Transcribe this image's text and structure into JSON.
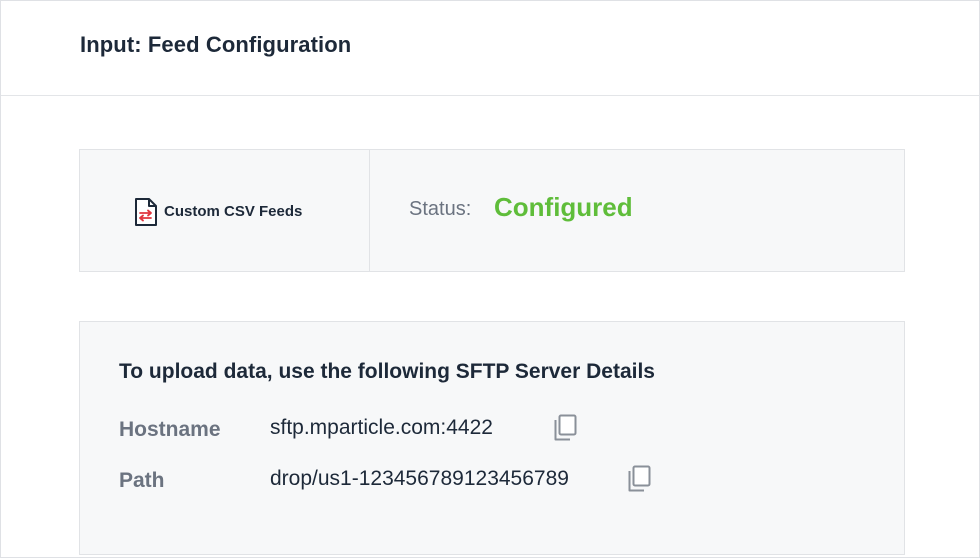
{
  "header": {
    "title": "Input: Feed Configuration"
  },
  "feed": {
    "icon": "csv-file-icon",
    "name": "Custom CSV Feeds"
  },
  "status": {
    "label": "Status:",
    "value": "Configured",
    "color": "#5fbd3a"
  },
  "sftp": {
    "heading": "To upload data, use the following SFTP Server Details",
    "fields": [
      {
        "label": "Hostname",
        "value": "sftp.mparticle.com:4422",
        "icon": "copy-icon"
      },
      {
        "label": "Path",
        "value": "drop/us1-123456789123456789",
        "icon": "copy-icon"
      }
    ]
  }
}
